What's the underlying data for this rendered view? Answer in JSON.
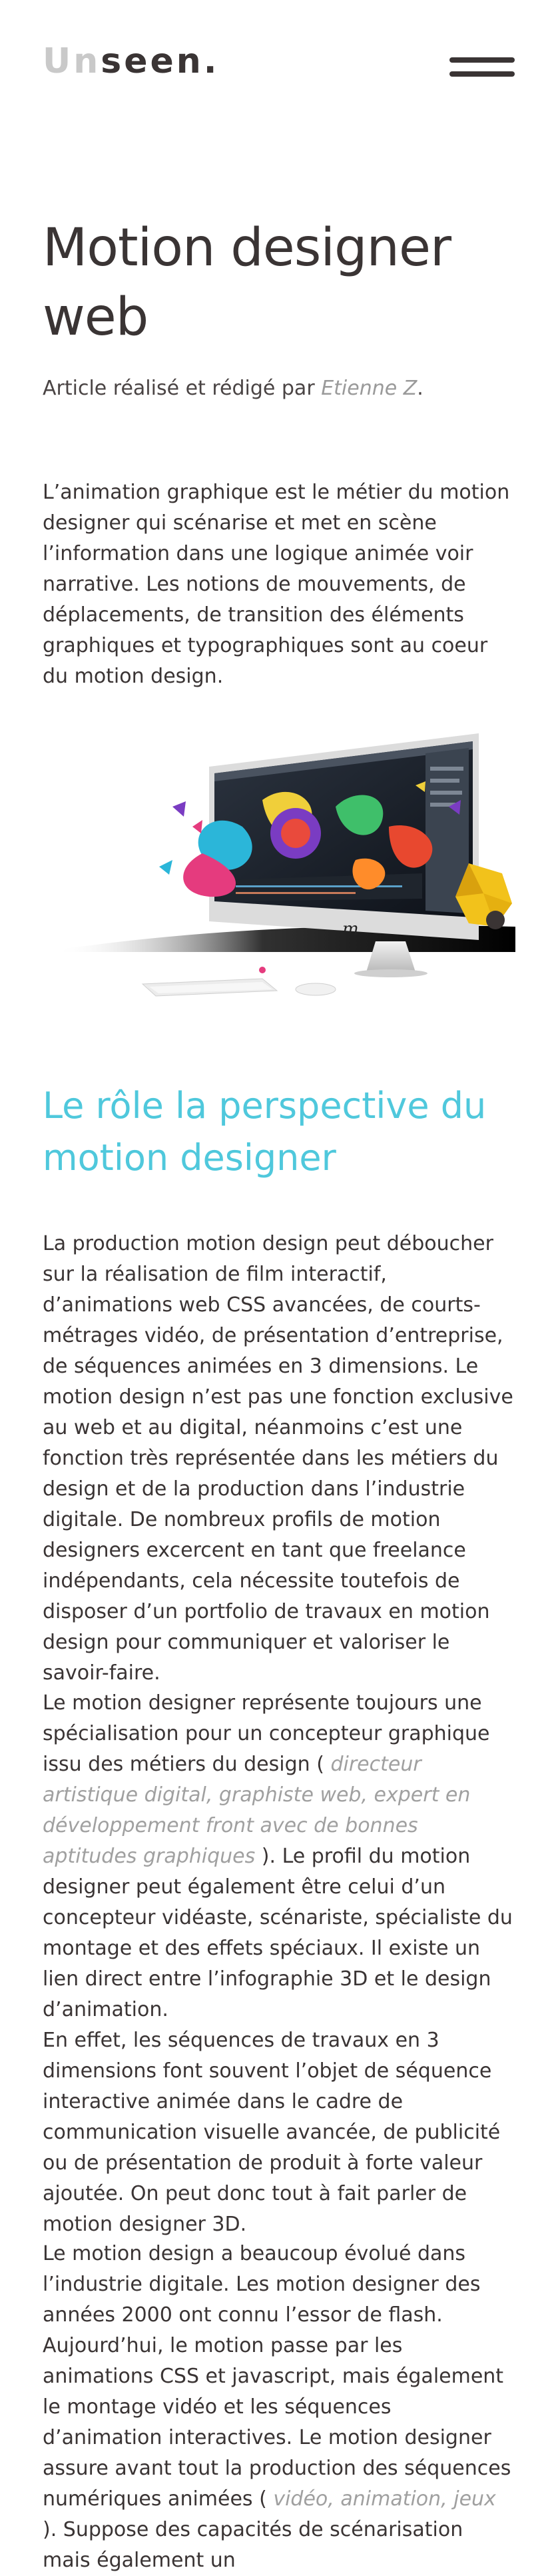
{
  "header": {
    "logo_light": "Un",
    "logo_dark": "seen.",
    "menu_icon": "hamburger-icon"
  },
  "article": {
    "title": "Motion designer web",
    "byline_prefix": "Article réalisé et rédigé par ",
    "author": "Etienne Z",
    "byline_suffix": ".",
    "intro": "L’animation graphique est le métier du motion designer qui scénarise et met en scène l’information dans une logique animée voir narrative. Les notions de mouvements, de déplacements, de transition des éléments graphiques et typographiques sont au coeur du motion design.",
    "hero_image": "computer-monitor-motion-design-illustration",
    "section_title": "Le rôle la perspective du motion designer",
    "p1": "La production motion design peut déboucher sur la réalisation de film interactif, d’animations web CSS avancées, de courts-métrages vidéo, de présentation d’entreprise, de séquences animées en 3 dimensions. Le motion design n’est pas une fonction exclusive au web et au digital, néanmoins c’est une fonction très représentée dans les métiers du design et de la production dans l’industrie digitale. De nombreux profils de motion designers excercent en tant que freelance indépendants, cela nécessite toutefois de disposer d’un portfolio de travaux en motion design pour communiquer et valoriser le savoir-faire.",
    "p2_a": "Le motion designer représente toujours une spécialisation pour un concepteur graphique issu des métiers du design ( ",
    "p2_muted": "directeur artistique digital, graphiste web, expert en développement front avec de bonnes aptitudes graphiques",
    "p2_b": " ). Le profil du motion designer peut également être celui d’un concepteur vidéaste, scénariste, spécialiste du montage et des effets spéciaux. Il existe un lien direct entre l’infographie 3D et le design d’animation.",
    "p2_c": "En effet, les séquences de travaux en 3 dimensions font souvent l’objet de séquence interactive animée dans le cadre de communication visuelle avancée, de publicité ou de présentation de produit à forte valeur ajoutée. On peut donc tout à fait parler de motion designer 3D.",
    "p3_a": "Le motion design a beaucoup évolué dans l’industrie digitale. Les motion designer des années 2000 ont connu l’essor de flash. Aujourd’hui, le motion passe par les animations CSS et javascript, mais également le montage vidéo et les séquences d’animation interactives. Le motion designer assure avant tout la production des séquences numériques animées ( ",
    "p3_muted": "vidéo, animation, jeux",
    "p3_b": " ). Suppose des capacités de scénarisation mais également un"
  },
  "colors": {
    "text": "#3a3434",
    "accent": "#4fc8dc",
    "muted": "#a0a0a0"
  }
}
